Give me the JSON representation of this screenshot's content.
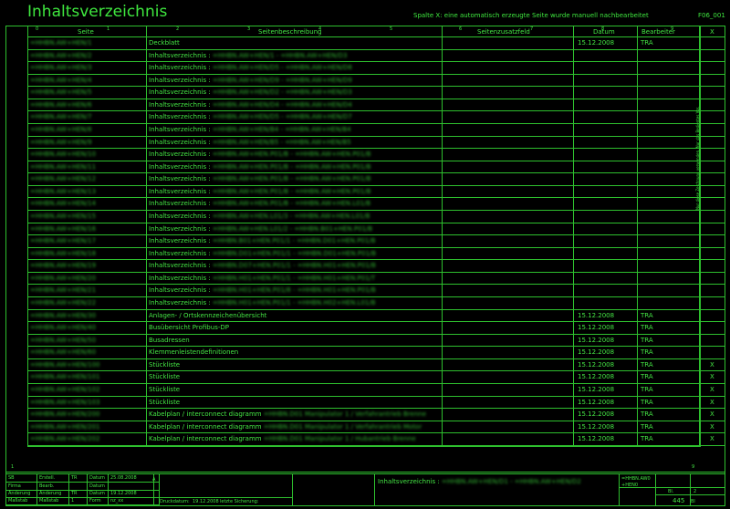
{
  "page": {
    "title": "Inhaltsverzeichnis",
    "note": "Spalte X: eine automatisch erzeugte Seite wurde manuell nachbearbeitet",
    "code": "F06_001",
    "side_note": "Nur diese Zeichnung verwenden, Nur das Bedientes Vor."
  },
  "table": {
    "ruler": [
      "0",
      "1",
      "2",
      "3",
      "4",
      "5",
      "6",
      "7",
      "8",
      "9"
    ],
    "headers": {
      "seite": "Seite",
      "beschreibung": "Seitenbeschreibung",
      "zusatz": "Seitenzusatzfeld",
      "datum": "Datum",
      "bearbeiter": "Bearbeiter",
      "x": "X"
    },
    "rows": [
      {
        "seite": "=HHBN.AW+HEN/1",
        "beschreibung": "Deckblatt",
        "desc_blur": "",
        "datum": "15.12.2008",
        "bearbeiter": "TRA",
        "x": ""
      },
      {
        "seite": "=HHBN.AW+HEN/2",
        "beschreibung": "Inhaltsverzeichnis : ",
        "desc_blur": "=HHBN.AW+HEN/1 - =HHBN.AW+HEN/D3",
        "datum": "",
        "bearbeiter": "",
        "x": ""
      },
      {
        "seite": "=HHBN.AW+HEN/3",
        "beschreibung": "Inhaltsverzeichnis : ",
        "desc_blur": "=HHBN.AW+HEN/D5 - =HHBN.AW+HEN/D8",
        "datum": "",
        "bearbeiter": "",
        "x": ""
      },
      {
        "seite": "=HHBN.AW+HEN/4",
        "beschreibung": "Inhaltsverzeichnis : ",
        "desc_blur": "=HHBN.AW+HEN/D9 - =HHBN.AW+HEN/D9",
        "datum": "",
        "bearbeiter": "",
        "x": ""
      },
      {
        "seite": "=HHBN.AW+HEN/5",
        "beschreibung": "Inhaltsverzeichnis : ",
        "desc_blur": "=HHBN.AW+HEN/D2 - =HHBN.AW+HEN/D3",
        "datum": "",
        "bearbeiter": "",
        "x": ""
      },
      {
        "seite": "=HHBN.AW+HEN/6",
        "beschreibung": "Inhaltsverzeichnis : ",
        "desc_blur": "=HHBN.AW+HEN/D4 - =HHBN.AW+HEN/D4",
        "datum": "",
        "bearbeiter": "",
        "x": ""
      },
      {
        "seite": "=HHBN.AW+HEN/7",
        "beschreibung": "Inhaltsverzeichnis : ",
        "desc_blur": "=HHBN.AW+HEN/D5 - =HHBN.AW+HEN/D7",
        "datum": "",
        "bearbeiter": "",
        "x": ""
      },
      {
        "seite": "=HHBN.AW+HEN/8",
        "beschreibung": "Inhaltsverzeichnis : ",
        "desc_blur": "=HHBN.AW+HEN/B4 - =HHBN.AW+HEN/B4",
        "datum": "",
        "bearbeiter": "",
        "x": ""
      },
      {
        "seite": "=HHBN.AW+HEN/9",
        "beschreibung": "Inhaltsverzeichnis : ",
        "desc_blur": "=HHBN.AW+HEN/B5 - =HHBN.AW+HEN/B5",
        "datum": "",
        "bearbeiter": "",
        "x": ""
      },
      {
        "seite": "=HHBN.AW+HEN/10",
        "beschreibung": "Inhaltsverzeichnis : ",
        "desc_blur": "=HHBN.AW+HEN.P01/B - =HHBN.AW+HEN.P01/B",
        "datum": "",
        "bearbeiter": "",
        "x": ""
      },
      {
        "seite": "=HHBN.AW+HEN/11",
        "beschreibung": "Inhaltsverzeichnis : ",
        "desc_blur": "=HHBN.AW+HEN.P01/B - =HHBN.AW+HEN.P01/B",
        "datum": "",
        "bearbeiter": "",
        "x": ""
      },
      {
        "seite": "=HHBN.AW+HEN/12",
        "beschreibung": "Inhaltsverzeichnis : ",
        "desc_blur": "=HHBN.AW+HEN.P01/B - =HHBN.AW+HEN.P01/B",
        "datum": "",
        "bearbeiter": "",
        "x": ""
      },
      {
        "seite": "=HHBN.AW+HEN/13",
        "beschreibung": "Inhaltsverzeichnis : ",
        "desc_blur": "=HHBN.AW+HEN.P01/B - =HHBN.AW+HEN.P01/B",
        "datum": "",
        "bearbeiter": "",
        "x": ""
      },
      {
        "seite": "=HHBN.AW+HEN/14",
        "beschreibung": "Inhaltsverzeichnis : ",
        "desc_blur": "=HHBN.AW+HEN.P01/B - =HHBN.AW+HEN.L01/B",
        "datum": "",
        "bearbeiter": "",
        "x": ""
      },
      {
        "seite": "=HHBN.AW+HEN/15",
        "beschreibung": "Inhaltsverzeichnis : ",
        "desc_blur": "=HHBN.AW+HEN.L01/3 - =HHBN.AW+HEN.L01/B",
        "datum": "",
        "bearbeiter": "",
        "x": ""
      },
      {
        "seite": "=HHBN.AW+HEN/16",
        "beschreibung": "Inhaltsverzeichnis : ",
        "desc_blur": "=HHBN.AW+HEN.L01/2 - =HHBN.B01+HEN.P01/B",
        "datum": "",
        "bearbeiter": "",
        "x": ""
      },
      {
        "seite": "=HHBN.AW+HEN/17",
        "beschreibung": "Inhaltsverzeichnis : ",
        "desc_blur": "=HHBN.B01+HEN.P01/1 - =HHBN.D01+HEN.P01/B",
        "datum": "",
        "bearbeiter": "",
        "x": ""
      },
      {
        "seite": "=HHBN.AW+HEN/18",
        "beschreibung": "Inhaltsverzeichnis : ",
        "desc_blur": "=HHBN.D01+HEN.P01/1 - =HHBN.D01+HEN.P01/B",
        "datum": "",
        "bearbeiter": "",
        "x": ""
      },
      {
        "seite": "=HHBN.AW+HEN/19",
        "beschreibung": "Inhaltsverzeichnis : ",
        "desc_blur": "=HHBN.D07+HEN.P01/1 - =HHBN.H01+HEN.P01/B",
        "datum": "",
        "bearbeiter": "",
        "x": ""
      },
      {
        "seite": "=HHBN.AW+HEN/20",
        "beschreibung": "Inhaltsverzeichnis : ",
        "desc_blur": "=HHBN.H01+HEN.P01/1 - =HHBN.H01+HEN.P01/T",
        "datum": "",
        "bearbeiter": "",
        "x": ""
      },
      {
        "seite": "=HHBN.AW+HEN/21",
        "beschreibung": "Inhaltsverzeichnis : ",
        "desc_blur": "=HHBN.H01+HEN.P01/8 - =HHBN.H01+HEN.P01/B",
        "datum": "",
        "bearbeiter": "",
        "x": ""
      },
      {
        "seite": "=HHBN.AW+HEN/22",
        "beschreibung": "Inhaltsverzeichnis : ",
        "desc_blur": "=HHBN.H01+HEN.P01/1 - =HHBN.H02+HEN.L01/B",
        "datum": "",
        "bearbeiter": "",
        "x": ""
      },
      {
        "seite": "=HHBN.AW+HEN/30",
        "beschreibung": "Anlagen- / Ortskennzeichenübersicht",
        "desc_blur": "",
        "datum": "15.12.2008",
        "bearbeiter": "TRA",
        "x": ""
      },
      {
        "seite": "=HHBN.AW+HEN/40",
        "beschreibung": "Busübersicht Profibus-DP",
        "desc_blur": "",
        "datum": "15.12.2008",
        "bearbeiter": "TRA",
        "x": ""
      },
      {
        "seite": "=HHBN.AW+HEN/50",
        "beschreibung": "Busadressen",
        "desc_blur": "",
        "datum": "15.12.2008",
        "bearbeiter": "TRA",
        "x": ""
      },
      {
        "seite": "=HHBN.AW+HEN/60",
        "beschreibung": "Klemmenleistendefinitionen",
        "desc_blur": "",
        "datum": "15.12.2008",
        "bearbeiter": "TRA",
        "x": ""
      },
      {
        "seite": "=HHBN.AW+HEN/100",
        "beschreibung": "Stückliste",
        "desc_blur": "",
        "datum": "15.12.2008",
        "bearbeiter": "TRA",
        "x": "X"
      },
      {
        "seite": "=HHBN.AW+HEN/101",
        "beschreibung": "Stückliste",
        "desc_blur": "",
        "datum": "15.12.2008",
        "bearbeiter": "TRA",
        "x": "X"
      },
      {
        "seite": "=HHBN.AW+HEN/102",
        "beschreibung": "Stückliste",
        "desc_blur": "",
        "datum": "15.12.2008",
        "bearbeiter": "TRA",
        "x": "X"
      },
      {
        "seite": "=HHBN.AW+HEN/103",
        "beschreibung": "Stückliste",
        "desc_blur": "",
        "datum": "15.12.2008",
        "bearbeiter": "TRA",
        "x": "X"
      },
      {
        "seite": "=HHBN.AW+HEN/200",
        "beschreibung": "Kabelplan / interconnect diagramm",
        "desc_blur": "=HHBN.D01 Manipulator 1 / Verfahrantrieb Brenne",
        "datum": "15.12.2008",
        "bearbeiter": "TRA",
        "x": "X"
      },
      {
        "seite": "=HHBN.AW+HEN/201",
        "beschreibung": "Kabelplan / interconnect diagramm",
        "desc_blur": "=HHBN.D01 Manipulator 1 / Verfahrantrieb Motor",
        "datum": "15.12.2008",
        "bearbeiter": "TRA",
        "x": "X"
      },
      {
        "seite": "=HHBN.AW+HEN/202",
        "beschreibung": "Kabelplan / interconnect diagramm",
        "desc_blur": "=HHBN.D01 Manipulator 1 / Hubantrieb Brenne",
        "datum": "15.12.2008",
        "bearbeiter": "TRA",
        "x": "X"
      }
    ]
  },
  "footer": {
    "bottom_nums": {
      "left": "1",
      "right": "9"
    },
    "c1": [
      "SB",
      "Firma",
      "Änderung",
      "Maßstab"
    ],
    "c2": [
      "Erstell.",
      "Bearb.",
      "Änderung",
      "Maßstab"
    ],
    "c3": [
      "TR",
      "",
      "TR",
      "1"
    ],
    "c4": [
      "Datum",
      "Datum",
      "Datum",
      "Form"
    ],
    "c5": [
      "25.08.2008",
      "",
      "19.12.2008",
      "nz_xx"
    ],
    "mark_a": "A",
    "druckdatum_label": "Druckdatum:",
    "druckdatum": "19.12.2008",
    "sicherung_label": "letzte Sicherung:",
    "center_title": "Inhaltsverzeichnis : ",
    "center_blur": "=HHBN.AW+HEN/D1 - =HHBN.AW+HEN/D2",
    "right_top": "=HHBN.AW0",
    "right_mid": "+HEN0",
    "bl_label": "Bl.",
    "bl_value": "2",
    "pages": "445",
    "pages_suffix": "Bl"
  }
}
